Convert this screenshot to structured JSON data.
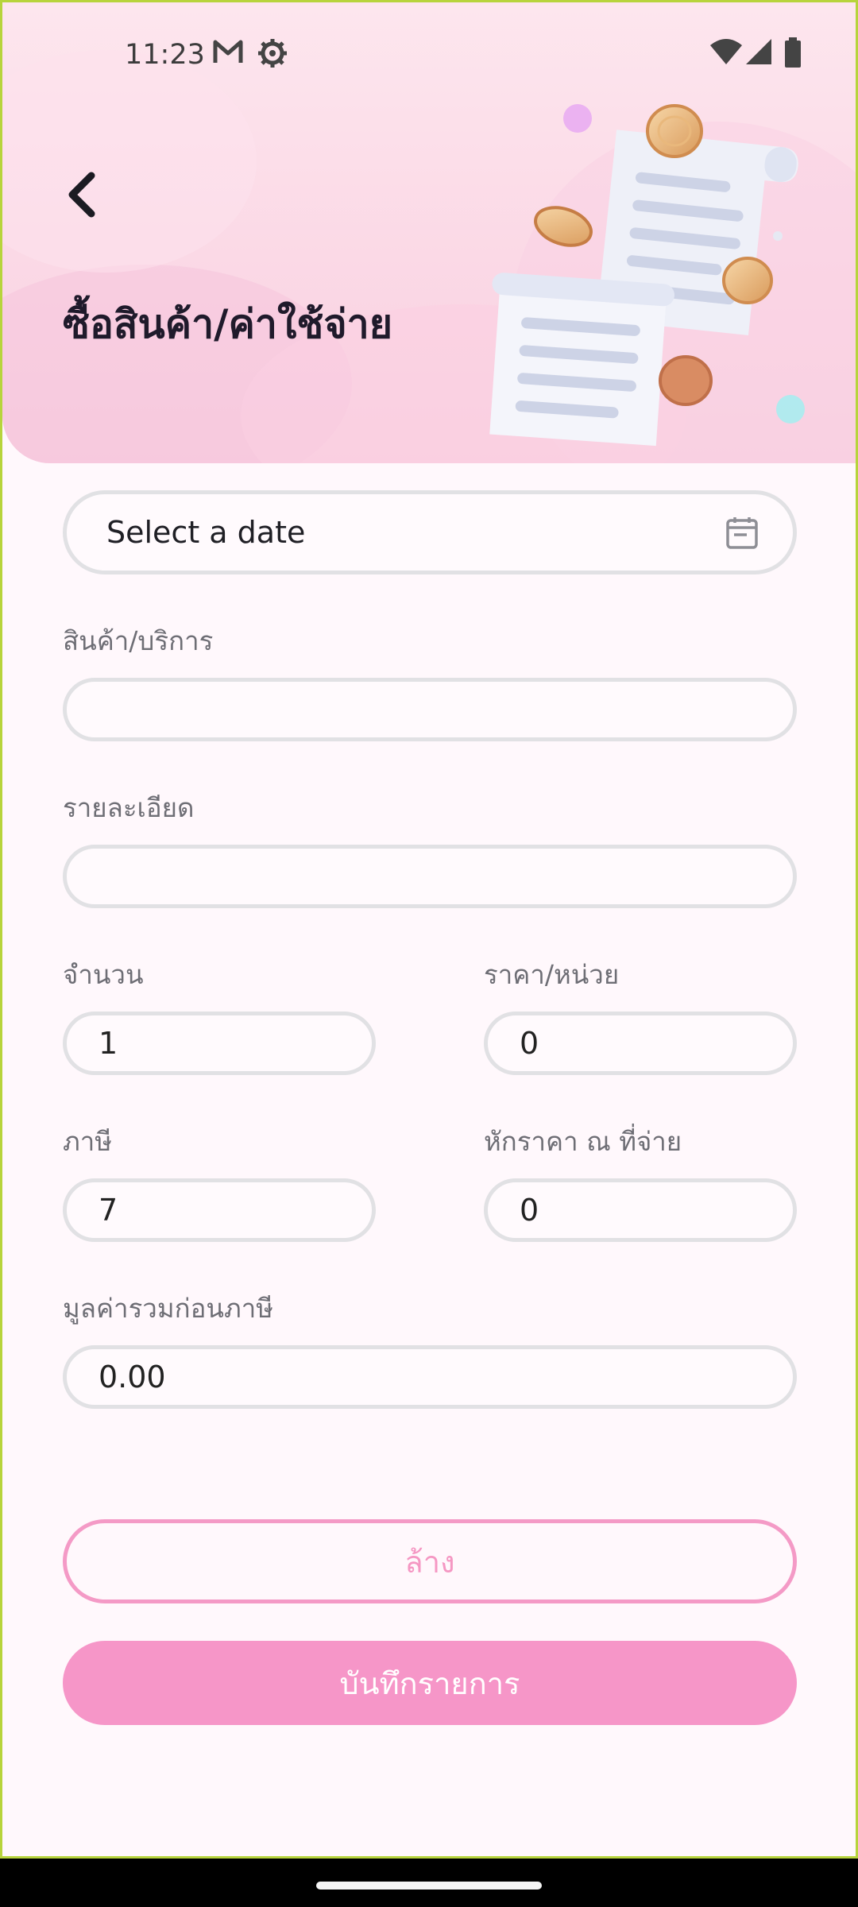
{
  "status_bar": {
    "time": "11:23",
    "icons": [
      "gmail-icon",
      "settings-icon",
      "wifi-icon",
      "signal-icon",
      "battery-icon"
    ]
  },
  "header": {
    "title": "ซื้อสินค้า/ค่าใช้จ่าย",
    "back_icon": "chevron-left-icon",
    "illustration": "receipt-coins-illustration"
  },
  "form": {
    "date": {
      "placeholder": "Select a date",
      "icon": "calendar-icon"
    },
    "product": {
      "label": "สินค้า/บริการ",
      "value": ""
    },
    "detail": {
      "label": "รายละเอียด",
      "value": ""
    },
    "quantity": {
      "label": "จำนวน",
      "value": "1"
    },
    "unit_price": {
      "label": "ราคา/หน่วย",
      "value": "0"
    },
    "tax": {
      "label": "ภาษี",
      "value": "7"
    },
    "withholding": {
      "label": "หักราคา ณ ที่จ่าย",
      "value": "0"
    },
    "subtotal": {
      "label": "มูลค่ารวมก่อนภาษี",
      "value": "0.00"
    }
  },
  "actions": {
    "clear_label": "ล้าง",
    "save_label": "บันทึกรายการ"
  },
  "colors": {
    "accent": "#f696c8",
    "accent_border": "#f49ac6",
    "header_bg": "#fbd9e6",
    "page_bg": "#fff8fc",
    "field_border": "#e1e1e4"
  }
}
